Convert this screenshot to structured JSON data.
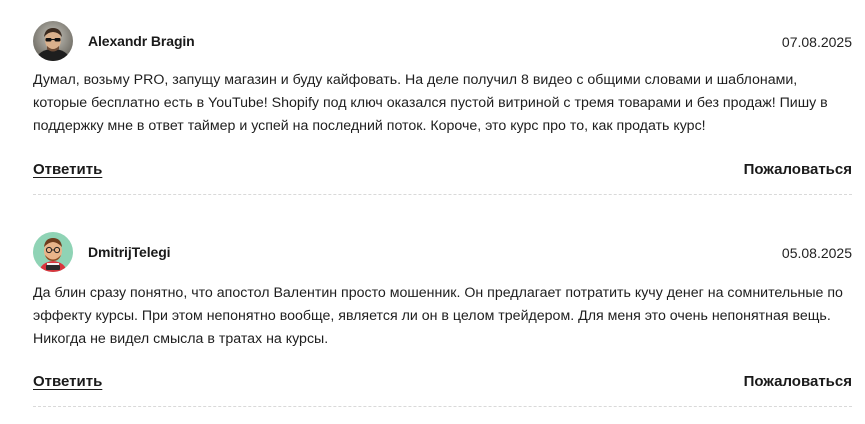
{
  "comments": [
    {
      "author": "Alexandr Bragin",
      "date": "07.08.2025",
      "text": "Думал, возьму PRO, запущу магазин и буду кайфовать. На деле получил 8 видео с общими словами и шаблонами, которые бесплатно есть в YouTube! Shopify под ключ оказался пустой витриной с тремя товарами и без продаж! Пишу в поддержку мне в ответ таймер и успей на последний поток. Короче, это курс про то, как продать курс!",
      "reply_label": "Ответить",
      "report_label": "Пожаловаться",
      "avatar_icon": "photo-avatar"
    },
    {
      "author": "DmitrijTelegi",
      "date": "05.08.2025",
      "text": "Да блин сразу понятно, что апостол Валентин просто мошенник. Он предлагает потратить кучу денег на сомнительные по эффекту курсы. При этом непонятно вообще, является ли он в целом трейдером. Для меня это очень непонятная вещь. Никогда не видел смысла в тратах на курсы.",
      "reply_label": "Ответить",
      "report_label": "Пожаловаться",
      "avatar_icon": "cartoon-avatar"
    }
  ]
}
